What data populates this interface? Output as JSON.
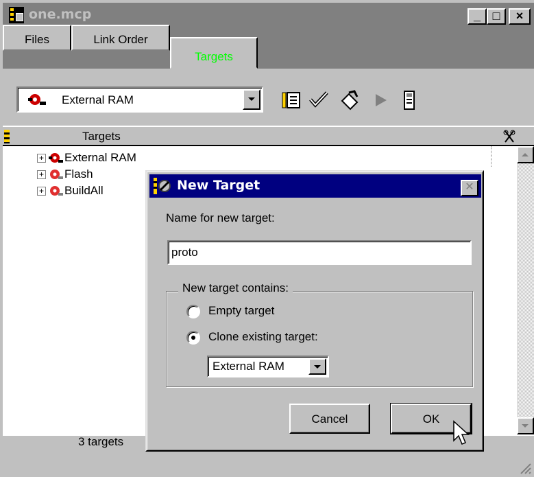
{
  "window": {
    "title": "one.mcp"
  },
  "caption_buttons": {
    "minimize": "_",
    "maximize": "□",
    "close": "×"
  },
  "tabs": [
    {
      "label": "Files"
    },
    {
      "label": "Link Order"
    },
    {
      "label": "Targets",
      "active": true
    }
  ],
  "toolbar": {
    "current_target": "External RAM",
    "icons": [
      "target-settings-icon",
      "check-syntax-icon",
      "make-icon",
      "run-icon",
      "debug-icon"
    ]
  },
  "list": {
    "column_header": "Targets",
    "items": [
      {
        "label": "External RAM",
        "active": true
      },
      {
        "label": "Flash"
      },
      {
        "label": "BuildAll"
      }
    ]
  },
  "status": {
    "text": "3 targets"
  },
  "dialog": {
    "title": "New Target",
    "name_label": "Name for new target:",
    "name_value": "proto",
    "group_label": "New target contains:",
    "option_empty": "Empty target",
    "option_clone": "Clone existing target:",
    "selected_option": "clone",
    "clone_source": "External RAM",
    "cancel_label": "Cancel",
    "ok_label": "OK"
  },
  "colors": {
    "active_tab_text": "#00ff00",
    "dialog_titlebar": "#000080",
    "window_titlebar_inactive": "#808080",
    "target_icon": "#cc0000"
  }
}
